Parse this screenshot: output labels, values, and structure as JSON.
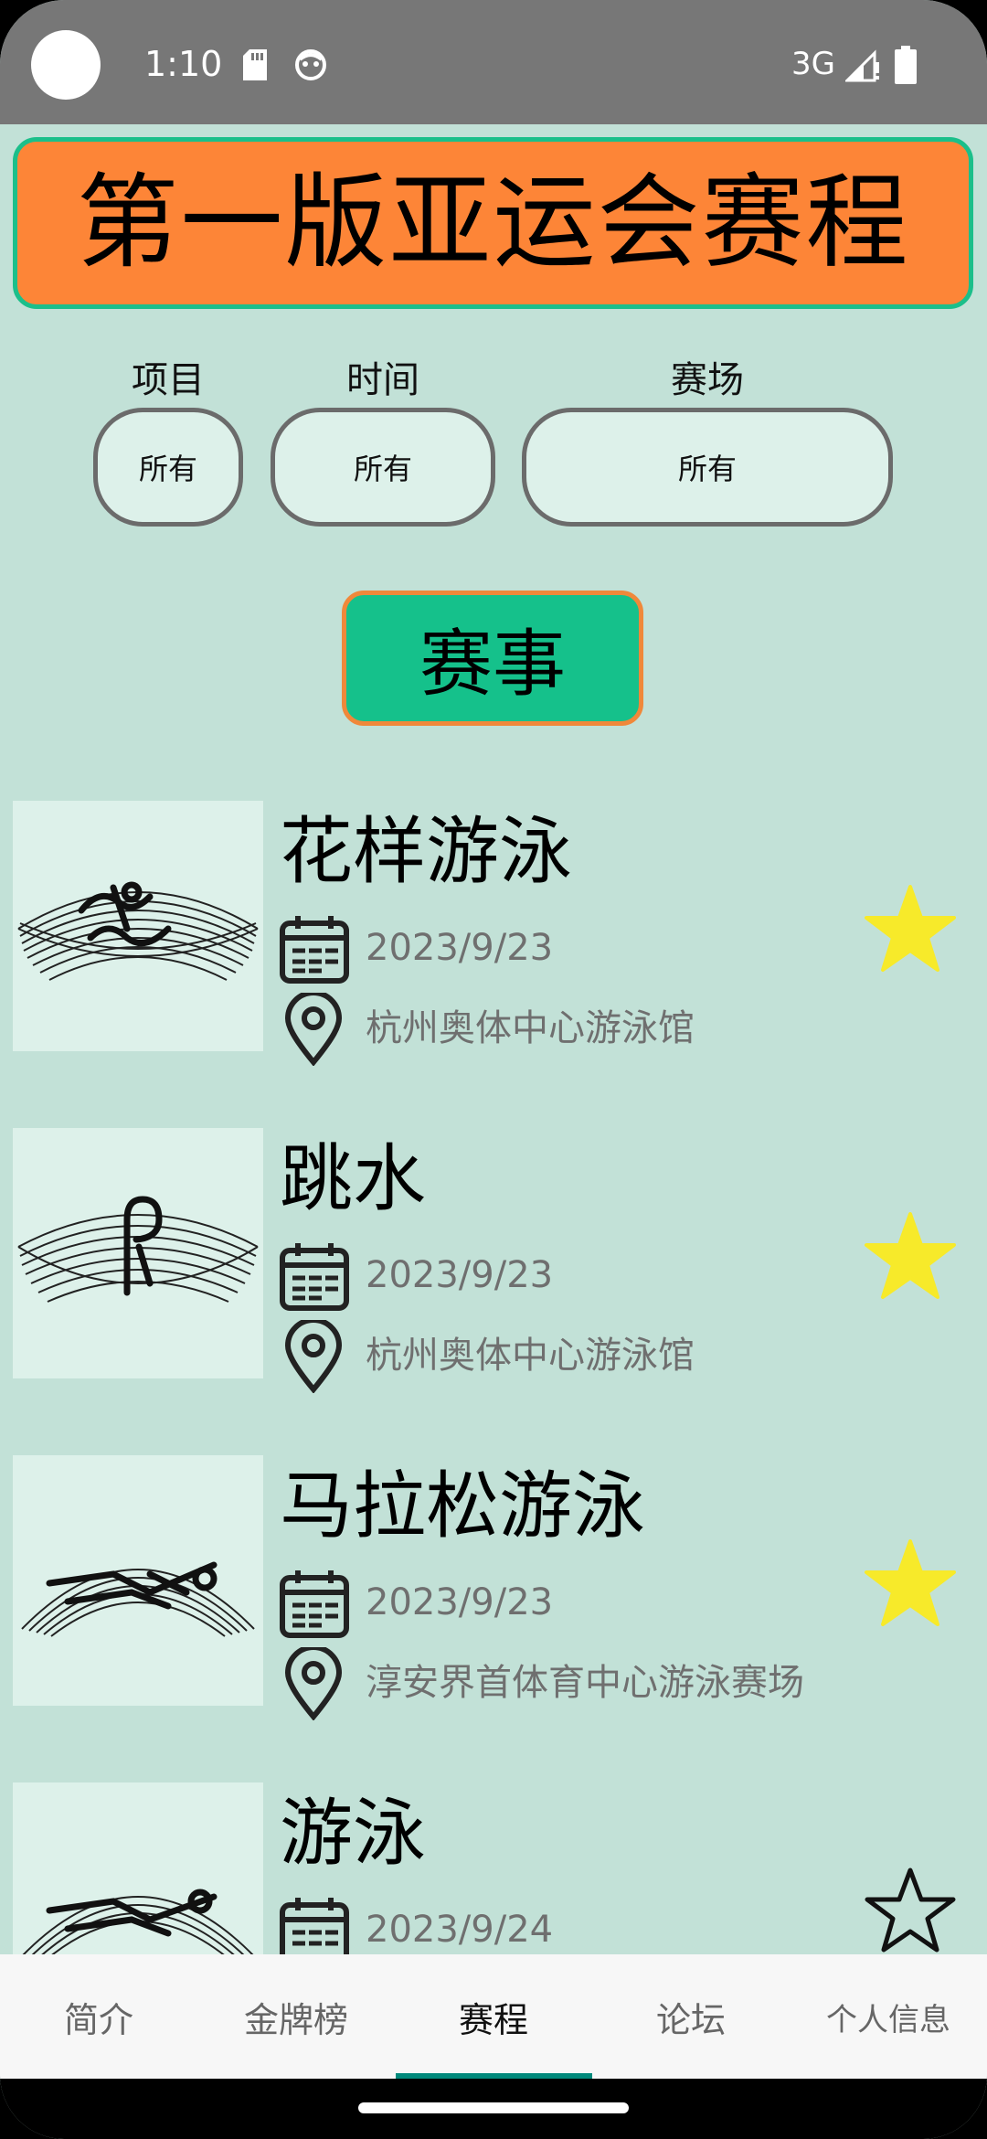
{
  "status_bar": {
    "time": "1:10",
    "network": "3G",
    "icons": [
      "sd-card-icon",
      "face-icon",
      "signal-icon",
      "battery-icon"
    ]
  },
  "header": {
    "title": "第一版亚运会赛程"
  },
  "filters": [
    {
      "label": "项目",
      "value": "所有"
    },
    {
      "label": "时间",
      "value": "所有"
    },
    {
      "label": "赛场",
      "value": "所有"
    }
  ],
  "events_button": "赛事",
  "events": [
    {
      "title": "花样游泳",
      "date": "2023/9/23",
      "venue": "杭州奥体中心游泳馆",
      "favorite": true,
      "icon": "artistic-swimming-pictogram"
    },
    {
      "title": "跳水",
      "date": "2023/9/23",
      "venue": "杭州奥体中心游泳馆",
      "favorite": true,
      "icon": "diving-pictogram"
    },
    {
      "title": "马拉松游泳",
      "date": "2023/9/23",
      "venue": "淳安界首体育中心游泳赛场",
      "favorite": true,
      "icon": "marathon-swimming-pictogram"
    },
    {
      "title": "游泳",
      "date": "2023/9/24",
      "venue": "",
      "favorite": false,
      "icon": "swimming-pictogram"
    }
  ],
  "bottom_nav": {
    "items": [
      "简介",
      "金牌榜",
      "赛程",
      "论坛",
      "个人信息"
    ],
    "active": "赛程"
  },
  "colors": {
    "background": "#c2e1d7",
    "title_bg": "#fd8537",
    "title_border": "#1bbf8a",
    "events_btn_bg": "#15c18b",
    "events_btn_border": "#f0883a",
    "star_filled": "#f7ea2a",
    "nav_indicator": "#00897b"
  }
}
